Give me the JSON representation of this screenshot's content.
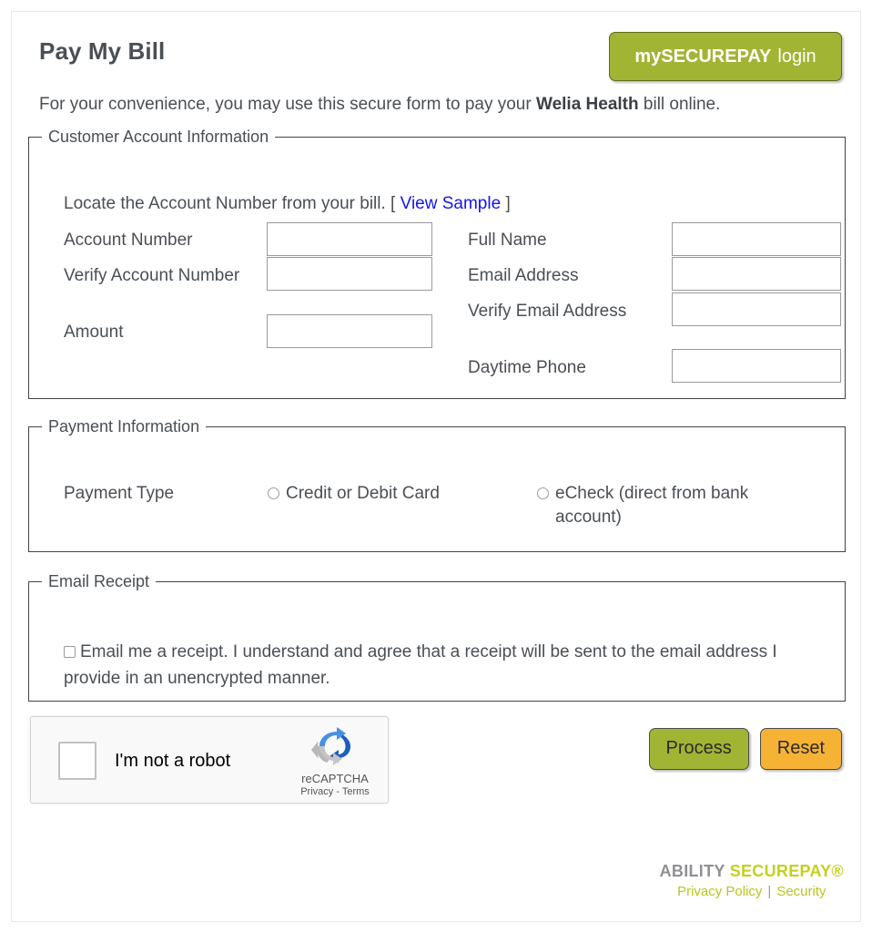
{
  "header": {
    "title": "Pay My Bill",
    "login_button": {
      "bold_text": "mySECUREPAY",
      "regular_text": "login"
    },
    "intro_before": "For your convenience, you may use this secure form to pay your ",
    "intro_bold": "Welia Health",
    "intro_after": " bill online."
  },
  "customer_section": {
    "legend": "Customer Account Information",
    "locate_text_before": "Locate the Account Number from your bill. [ ",
    "locate_link": "View Sample",
    "locate_text_after": " ]",
    "fields_left": [
      {
        "label": "Account Number",
        "value": "",
        "placeholder": ""
      },
      {
        "label": "Verify Account Number",
        "value": "",
        "placeholder": ""
      },
      {
        "label": "Amount",
        "value": "",
        "placeholder": ""
      }
    ],
    "fields_right": [
      {
        "label": "Full Name",
        "value": "",
        "placeholder": ""
      },
      {
        "label": "Email Address",
        "value": "",
        "placeholder": ""
      },
      {
        "label": "Verify Email Address",
        "value": "",
        "placeholder": ""
      },
      {
        "label": "Daytime Phone",
        "value": "",
        "placeholder": ""
      }
    ]
  },
  "payment_section": {
    "legend": "Payment Information",
    "type_label": "Payment Type",
    "options": [
      {
        "label": "Credit or Debit Card",
        "selected": false
      },
      {
        "label": "eCheck (direct from bank account)",
        "selected": false
      }
    ]
  },
  "receipt_section": {
    "legend": "Email Receipt",
    "checkbox_label": "Email me a receipt. I understand and agree that a receipt will be sent to the email address I provide in an unencrypted manner.",
    "checked": false
  },
  "captcha": {
    "label": "I'm not a robot",
    "brand": "reCAPTCHA",
    "links": "Privacy - Terms",
    "checked": false
  },
  "actions": {
    "process_label": "Process",
    "reset_label": "Reset"
  },
  "footer": {
    "logo_gray": "ABILITY",
    "logo_green": "SECUREPAY®",
    "privacy_link": "Privacy Policy",
    "separator": "|",
    "security_link": "Security"
  },
  "colors": {
    "brand_green": "#a2b434",
    "reset_amber": "#f5b235",
    "link_blue": "#1414ee",
    "footer_green": "#c3d11d",
    "footer_gray": "#8f9093",
    "text": "#4a4f55"
  }
}
